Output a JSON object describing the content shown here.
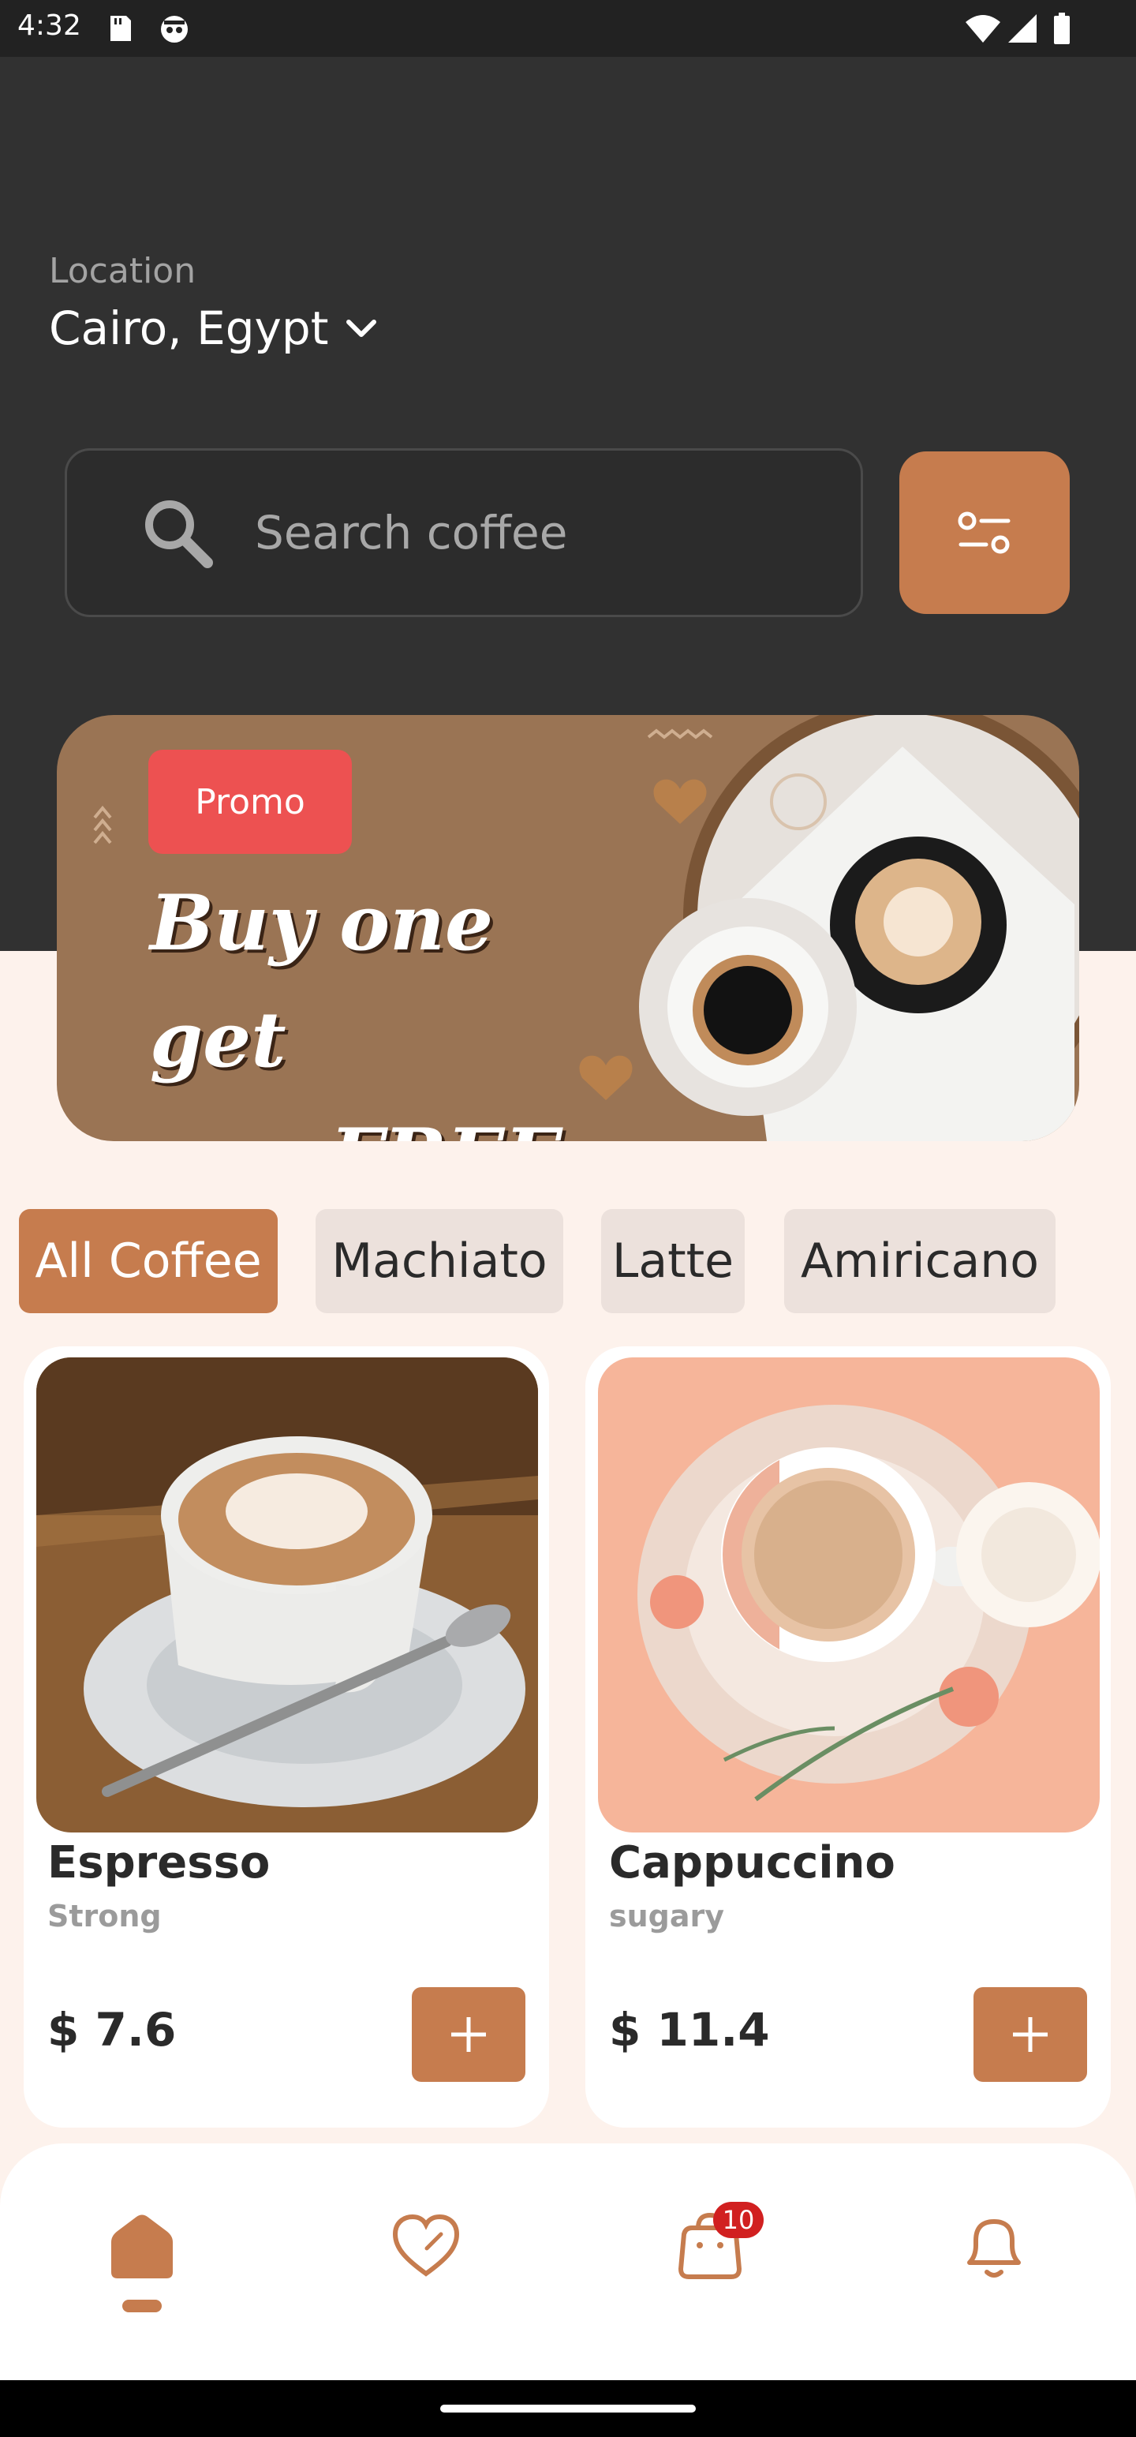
{
  "status_bar": {
    "time": "4:32"
  },
  "location": {
    "label": "Location",
    "value": "Cairo, Egypt"
  },
  "search": {
    "placeholder": "Search coffee"
  },
  "promo": {
    "badge": "Promo",
    "line1": "Buy one get",
    "line2": "one FREE"
  },
  "categories": [
    {
      "label": "All Coffee",
      "active": true
    },
    {
      "label": "Machiato",
      "active": false
    },
    {
      "label": "Latte",
      "active": false
    },
    {
      "label": "Amiricano",
      "active": false
    }
  ],
  "products": [
    {
      "name": "Espresso",
      "subtitle": "Strong",
      "price": "$ 7.6"
    },
    {
      "name": "Cappuccino",
      "subtitle": "sugary",
      "price": "$ 11.4"
    }
  ],
  "nav": {
    "cart_badge": "10"
  },
  "colors": {
    "accent": "#c67c4e",
    "promo_red": "#ed5151",
    "dark_bg": "#313131",
    "light_bg": "#fdf2ec"
  }
}
